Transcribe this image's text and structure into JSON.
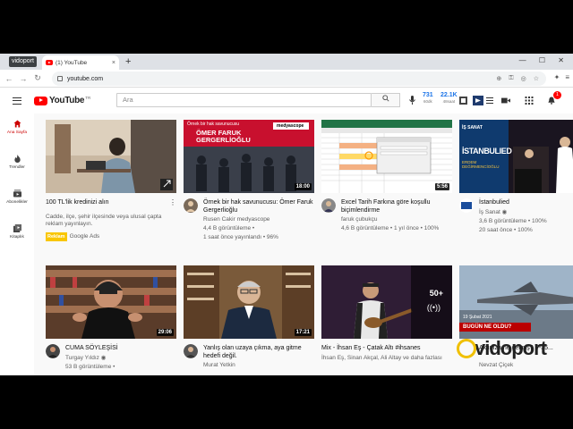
{
  "browser": {
    "tooltip": "vidoport",
    "tab_title": "(1) YouTube",
    "tab_close": "×",
    "new_tab": "+",
    "window_controls": "— ☐ ✕",
    "url": "youtube.com"
  },
  "header": {
    "logo_text": "YouTube",
    "logo_country": "TR",
    "search_placeholder": "Ara",
    "stat1_value": "731",
    "stat1_label": "60dk",
    "stat2_value": "22.1K",
    "stat2_label": "48saat",
    "notification_count": "1"
  },
  "sidebar": {
    "items": [
      {
        "label": "Ana Sayfa",
        "icon": "home-icon",
        "active": true
      },
      {
        "label": "Trendler",
        "icon": "fire-icon",
        "active": false
      },
      {
        "label": "Abonelikler",
        "icon": "subscriptions-icon",
        "active": false
      },
      {
        "label": "Kitaplık",
        "icon": "library-icon",
        "active": false
      }
    ]
  },
  "videos": [
    {
      "title": "100 TL'lik kredinizi alın",
      "channel": "Cadde, ilçe, şehir ilçesinde veya ulusal çapta reklam yayınlayın.",
      "stats": "Google Ads",
      "ad_label": "Reklam",
      "duration": "",
      "is_ad": true
    },
    {
      "title": "Örnek bir hak savunucusu: Ömer Faruk Gergerlioğlu",
      "channel": "Rusen Cakir medyascope",
      "stats": "4,4 B görüntüleme •",
      "stats2": "1 saat önce yayınlandı • 96%",
      "duration": "18:00",
      "thumb_caption_top": "Örnek bir hak savunucusu",
      "thumb_caption": "ÖMER FARUK GERGERLİOĞLU",
      "thumb_brand": "medyascope"
    },
    {
      "title": "Excel Tarih Farkına göre koşullu biçimlendirme",
      "channel": "faruk çubukçu",
      "stats": "4,6 B görüntüleme • 1 yıl önce • 100%",
      "duration": "5:56"
    },
    {
      "title": "İstanbulied",
      "channel": "İş Sanat ◉",
      "stats": "3,6 B görüntüleme • 100%",
      "stats2": "20 saat önce • 100%",
      "duration": "",
      "thumb_caption": "İSTANBULIED",
      "thumb_sub": "ERDEM DEĞİRMENCİOĞLU",
      "thumb_brand": "İŞ SANAT"
    },
    {
      "title": "CUMA SÖYLEŞİSİ",
      "channel": "Turgay Yıldız ◉",
      "stats": "53 B görüntüleme •",
      "duration": "29:06"
    },
    {
      "title": "Yanlış olan uzaya çıkma, aya gitme hedefi değil.",
      "channel": "Murat Yetkin",
      "stats": "",
      "duration": "17:21"
    },
    {
      "title": "Mix - İhsan Eş - Çatak Altı #ihsanes",
      "channel": "İhsan Eş, Sinan Akçal, Ali Altay ve daha fazlası",
      "stats": "",
      "duration": "",
      "mix_count": "50+"
    },
    {
      "title": "Aklınıza ne gelmiş? F-35...",
      "channel": "Nevzat Çiçek",
      "stats": "",
      "duration": "",
      "thumb_caption": "BUGÜN NE OLDU?",
      "thumb_date": "19 Şubat 2021"
    }
  ],
  "watermark": {
    "text": "vidoport"
  }
}
